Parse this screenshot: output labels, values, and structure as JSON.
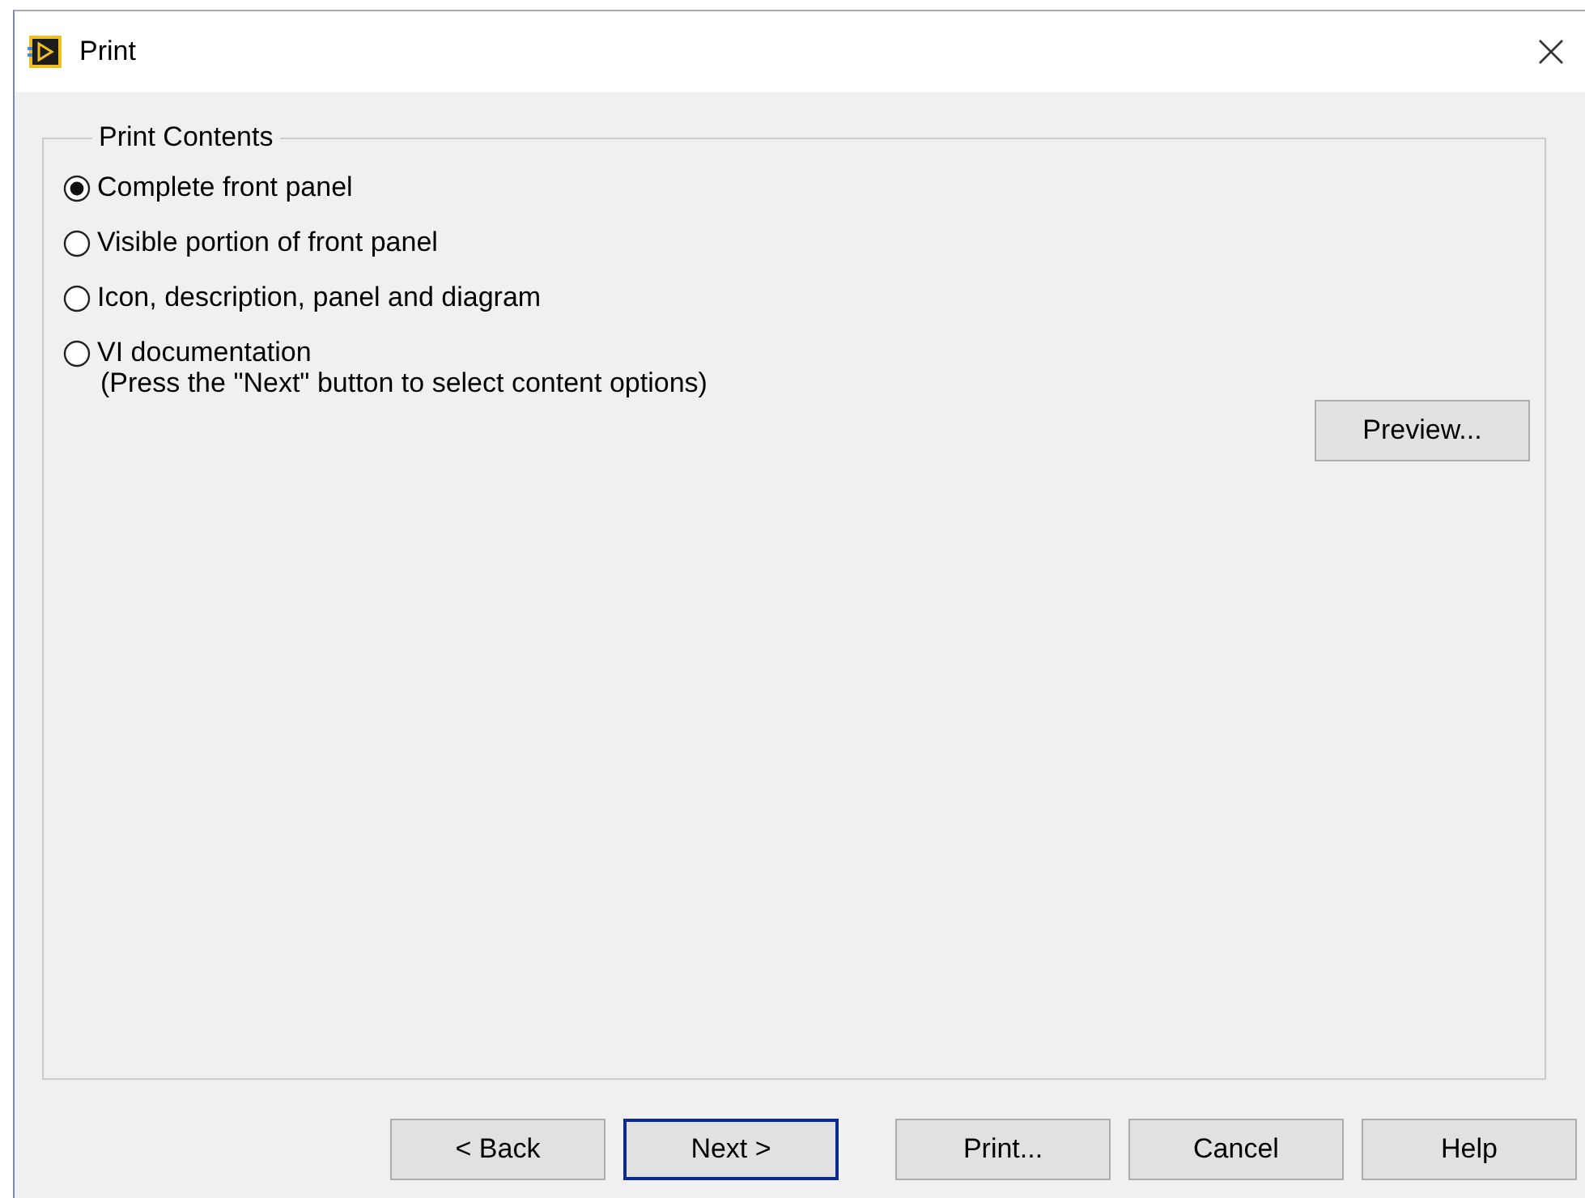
{
  "window": {
    "title": "Print"
  },
  "group": {
    "title": "Print Contents"
  },
  "options": [
    {
      "label": "Complete front panel",
      "selected": true
    },
    {
      "label": "Visible portion of front panel",
      "selected": false
    },
    {
      "label": "Icon, description, panel and diagram",
      "selected": false
    },
    {
      "label": "VI documentation",
      "selected": false,
      "note": "(Press the \"Next\" button to select content options)"
    }
  ],
  "preview_button": "Preview...",
  "buttons": [
    {
      "label": "< Back",
      "default": false
    },
    {
      "label": "Next >",
      "default": true
    },
    {
      "label": "Print...",
      "default": false
    },
    {
      "label": "Cancel",
      "default": false
    },
    {
      "label": "Help",
      "default": false
    }
  ]
}
